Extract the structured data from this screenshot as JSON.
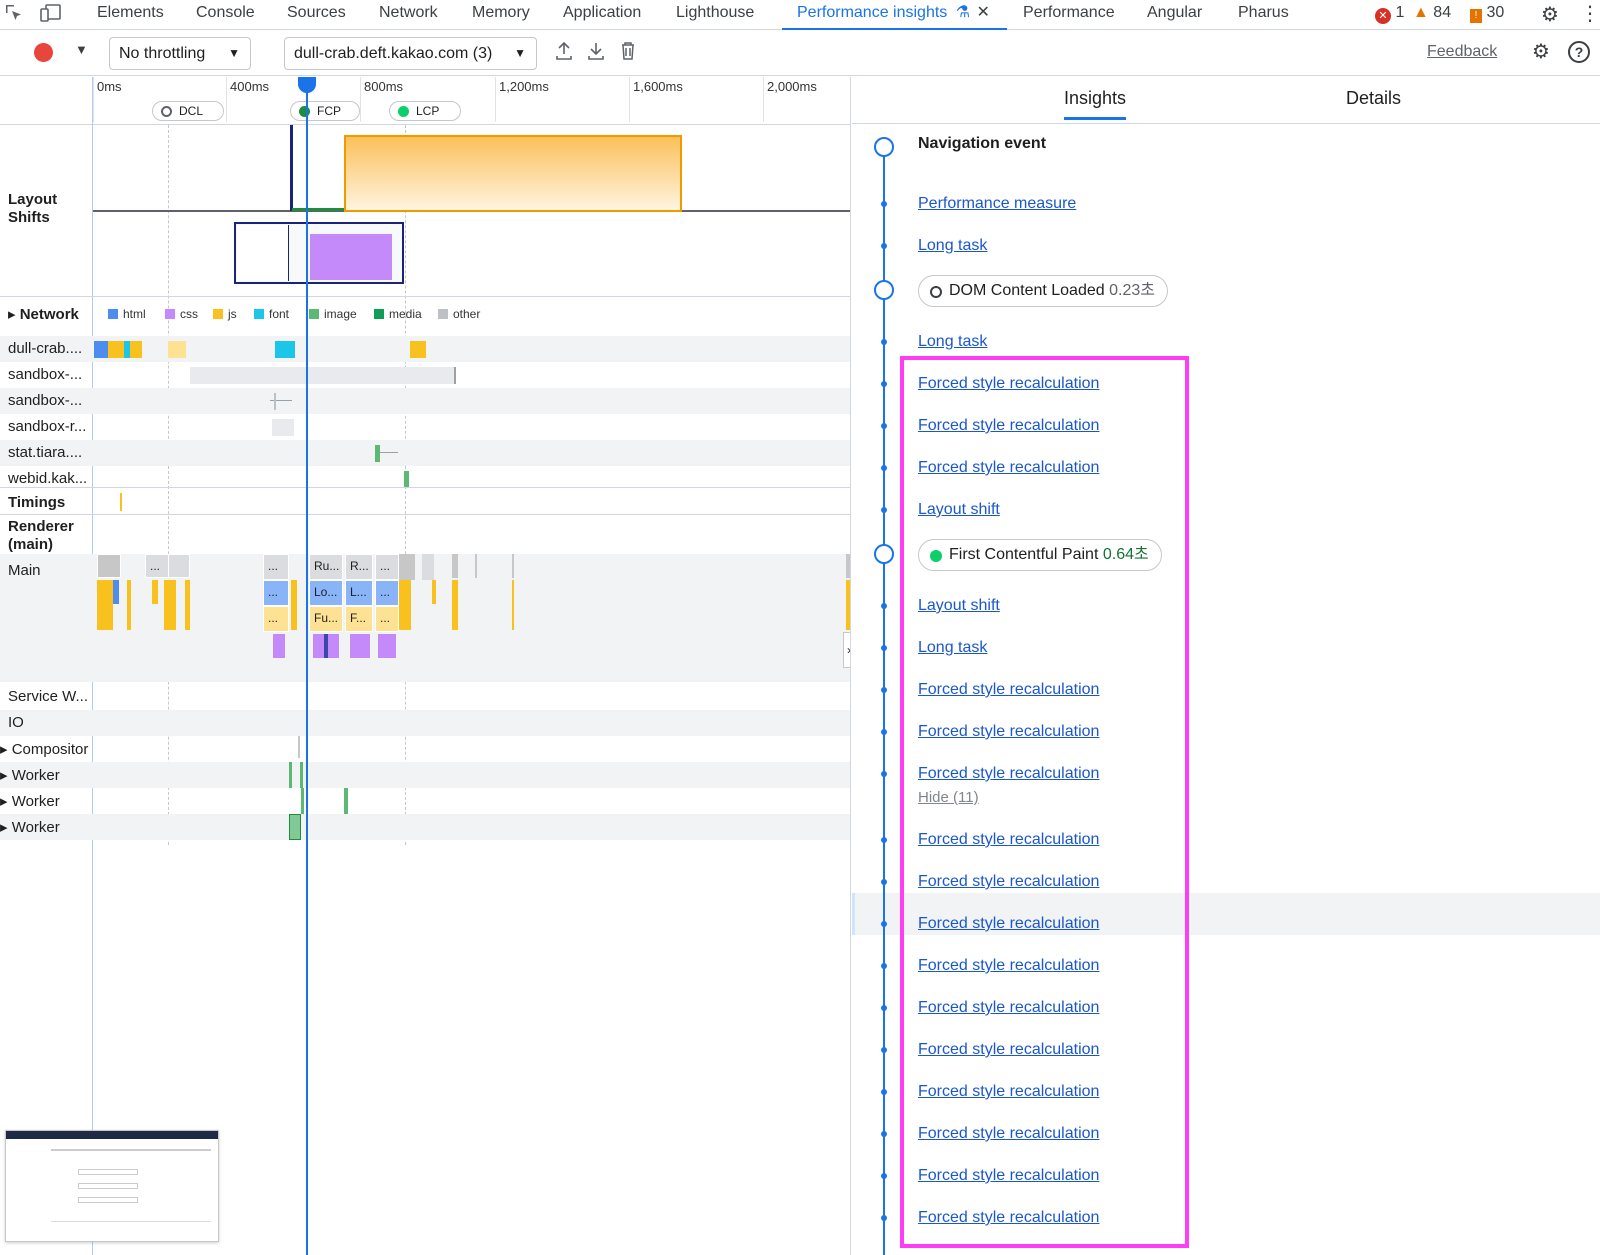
{
  "tabs": {
    "items": [
      "Elements",
      "Console",
      "Sources",
      "Network",
      "Memory",
      "Application",
      "Lighthouse",
      "Performance insights",
      "Performance",
      "Angular",
      "Pharus"
    ],
    "active": "Performance insights"
  },
  "counters": {
    "errors": "1",
    "warnings": "84",
    "issues": "30"
  },
  "toolbar": {
    "throttling": "No throttling",
    "recording": "dull-crab.deft.kakao.com (3)",
    "feedback": "Feedback"
  },
  "timeline": {
    "ticks": [
      "0ms",
      "400ms",
      "800ms",
      "1,200ms",
      "1,600ms",
      "2,000ms"
    ],
    "markers": {
      "dcl": "DCL",
      "fcp": "FCP",
      "lcp": "LCP"
    }
  },
  "tracks": {
    "layout_shifts": "Layout\nShifts",
    "network": "Network",
    "network_rows": [
      "dull-crab....",
      "sandbox-...",
      "sandbox-...",
      "sandbox-r...",
      "stat.tiara....",
      "webid.kak..."
    ],
    "timings": "Timings",
    "renderer": "Renderer\n(main)",
    "main": "Main",
    "other_rows": [
      "Service W...",
      "IO",
      "Compositor",
      "Worker",
      "Worker",
      "Worker"
    ]
  },
  "legend": {
    "items": [
      {
        "label": "html",
        "color": "#4f8cf0"
      },
      {
        "label": "css",
        "color": "#c58af9"
      },
      {
        "label": "js",
        "color": "#f9c11d"
      },
      {
        "label": "font",
        "color": "#1cc6e8"
      },
      {
        "label": "image",
        "color": "#5bb974"
      },
      {
        "label": "media",
        "color": "#0f9d58"
      },
      {
        "label": "other",
        "color": "#bdc1c6"
      }
    ]
  },
  "flame": {
    "row1": [
      "...",
      "...",
      "Ru...",
      "R...",
      "..."
    ],
    "row2": [
      "...",
      "Lo...",
      "L...",
      "..."
    ],
    "row3": [
      "...",
      "Fu...",
      "F...",
      "..."
    ]
  },
  "insights": {
    "tabs": {
      "insights": "Insights",
      "details": "Details"
    },
    "navigation": "Navigation event",
    "performance_measure": "Performance measure",
    "long_task": "Long task",
    "dcl": {
      "label": "DOM Content Loaded",
      "time": "0.23초"
    },
    "fcp": {
      "label": "First Contentful Paint",
      "time": "0.64초"
    },
    "forced": "Forced style recalculation",
    "layout_shift": "Layout shift",
    "hide": "Hide (11)"
  }
}
